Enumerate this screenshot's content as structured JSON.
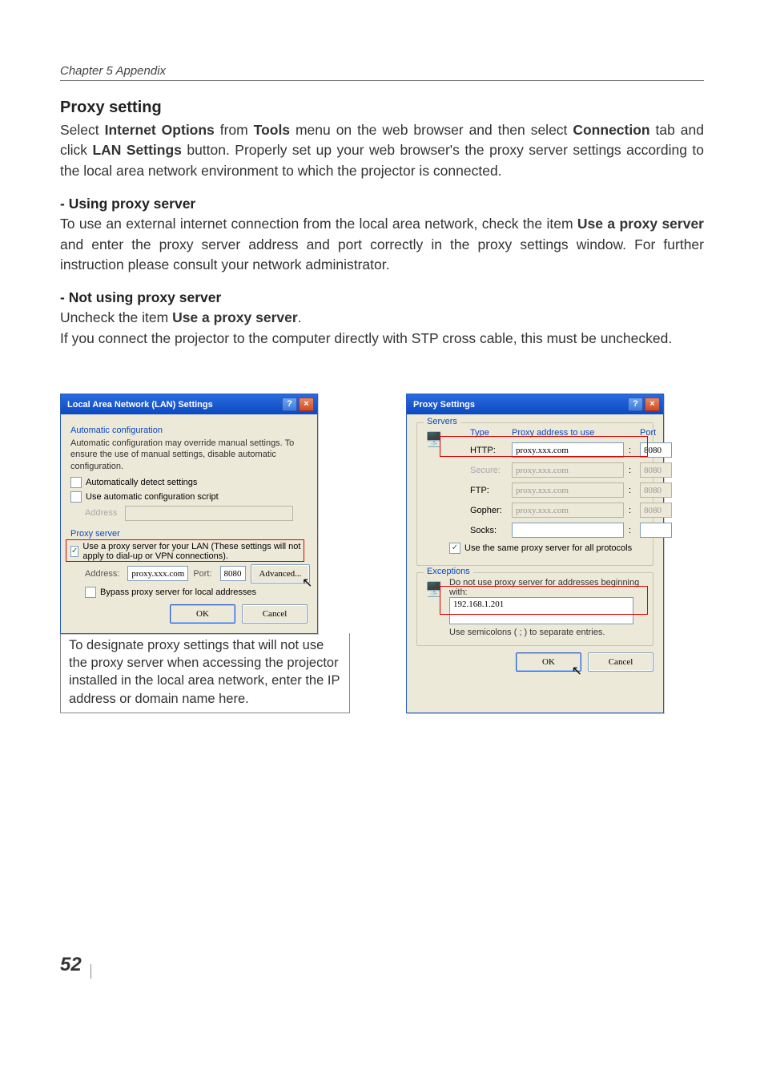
{
  "chapter": "Chapter 5 Appendix",
  "section_title": "Proxy setting",
  "intro_text_parts": {
    "p1a": "Select ",
    "p1b": "Internet Options",
    "p1c": " from ",
    "p1d": "Tools",
    "p1e": " menu on the web browser and then select ",
    "p1f": "Connection",
    "p1g": " tab and click ",
    "p1h": "LAN Settings",
    "p1i": " button. Properly set up your web browser's the proxy server settings according to the local area network environment to which the projector is connected."
  },
  "sub1_title": "- Using proxy server",
  "sub1_parts": {
    "a": "To use an external internet connection from the local area network, check the item ",
    "b": "Use a proxy server",
    "c": " and enter the proxy server address and port correctly in the proxy settings window. For further instruction please consult your network administrator."
  },
  "sub2_title": "- Not using proxy server",
  "sub2_line1a": "Uncheck the item ",
  "sub2_line1b": "Use a proxy server",
  "sub2_line1c": ".",
  "sub2_line2": "If you connect the projector to the computer directly with STP cross cable, this must be unchecked.",
  "lan_dialog": {
    "title": "Local Area Network (LAN) Settings",
    "group1_label": "Automatic configuration",
    "group1_desc": "Automatic configuration may override manual settings.  To ensure the use of manual settings, disable automatic configuration.",
    "chk_auto_detect": "Automatically detect settings",
    "chk_auto_script": "Use automatic configuration script",
    "addr_label_dis": "Address",
    "group2_label": "Proxy server",
    "chk_use_proxy": "Use a proxy server for your LAN (These settings will not apply to dial-up or VPN connections).",
    "addr_label": "Address:",
    "addr_value": "proxy.xxx.com",
    "port_label": "Port:",
    "port_value": "8080",
    "advanced_btn": "Advanced...",
    "chk_bypass": "Bypass proxy server for local addresses",
    "ok": "OK",
    "cancel": "Cancel",
    "note_below": "To designate proxy settings that will not use the proxy server when accessing the projector installed in the local area network, enter the IP address or domain name here."
  },
  "proxy_dialog": {
    "title": "Proxy Settings",
    "servers_label": "Servers",
    "col_type": "Type",
    "col_addr": "Proxy address to use",
    "col_port": "Port",
    "rows": {
      "http": {
        "label": "HTTP:",
        "addr": "proxy.xxx.com",
        "port": "8080",
        "enabled": true
      },
      "secure": {
        "label": "Secure:",
        "addr": "proxy.xxx.com",
        "port": "8080",
        "enabled": false
      },
      "ftp": {
        "label": "FTP:",
        "addr": "proxy.xxx.com",
        "port": "8080",
        "enabled": false
      },
      "gopher": {
        "label": "Gopher:",
        "addr": "proxy.xxx.com",
        "port": "8080",
        "enabled": false
      },
      "socks": {
        "label": "Socks:",
        "addr": "",
        "port": "",
        "enabled": true
      }
    },
    "chk_same": "Use the same proxy server for all protocols",
    "exceptions_label": "Exceptions",
    "exceptions_desc": "Do not use proxy server for addresses beginning with:",
    "exceptions_value": "192.168.1.201",
    "exceptions_hint": "Use semicolons ( ; ) to separate entries.",
    "ok": "OK",
    "cancel": "Cancel"
  },
  "page_number": "52"
}
